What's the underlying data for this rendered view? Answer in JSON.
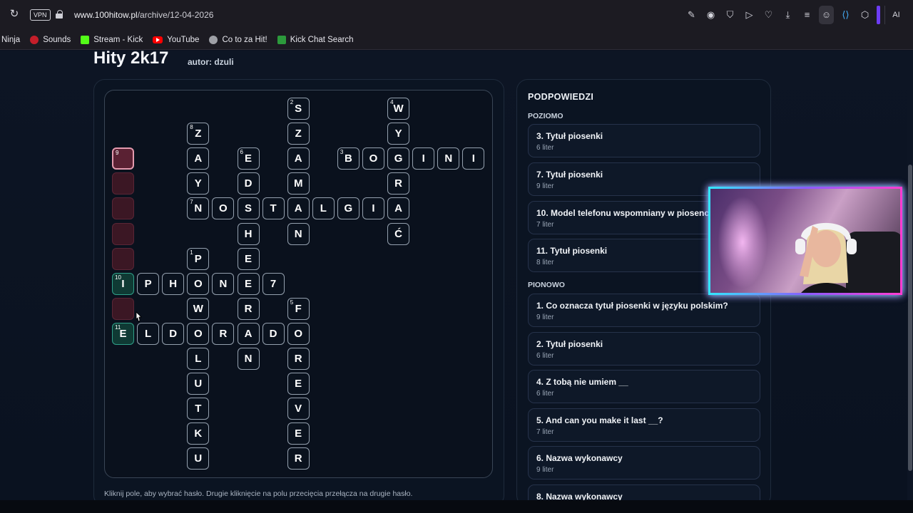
{
  "browser": {
    "vpn_label": "VPN",
    "url_host": "www.100hitow.pl",
    "url_path": "/archive/12-04-2026",
    "ai_label": "AI"
  },
  "bookmarks": [
    {
      "label": "Ninja",
      "icon": "none"
    },
    {
      "label": "Sounds",
      "icon": "sounds-icon"
    },
    {
      "label": "Stream - Kick",
      "icon": "kick-icon"
    },
    {
      "label": "YouTube",
      "icon": "youtube-icon"
    },
    {
      "label": "Co to za Hit!",
      "icon": "globe-icon"
    },
    {
      "label": "Kick Chat Search",
      "icon": "kick-chat-icon"
    }
  ],
  "page": {
    "title": "Hity 2k17",
    "author": "autor: dzuli",
    "hint": "Kliknij pole, aby wybrać hasło. Drugie kliknięcie na polu przecięcia przełącza na drugie hasło."
  },
  "crossword": {
    "cells": [
      {
        "c": 7,
        "r": 0,
        "ch": "S",
        "n": "2"
      },
      {
        "c": 11,
        "r": 0,
        "ch": "W",
        "n": "4"
      },
      {
        "c": 3,
        "r": 1,
        "ch": "Z",
        "n": "8"
      },
      {
        "c": 7,
        "r": 1,
        "ch": "Z"
      },
      {
        "c": 11,
        "r": 1,
        "ch": "Y"
      },
      {
        "c": 0,
        "r": 2,
        "ch": "",
        "n": "9",
        "style": "pink-sel"
      },
      {
        "c": 3,
        "r": 2,
        "ch": "A"
      },
      {
        "c": 5,
        "r": 2,
        "ch": "E",
        "n": "6"
      },
      {
        "c": 7,
        "r": 2,
        "ch": "A"
      },
      {
        "c": 9,
        "r": 2,
        "ch": "B",
        "n": "3"
      },
      {
        "c": 10,
        "r": 2,
        "ch": "O"
      },
      {
        "c": 11,
        "r": 2,
        "ch": "G"
      },
      {
        "c": 12,
        "r": 2,
        "ch": "I"
      },
      {
        "c": 13,
        "r": 2,
        "ch": "N"
      },
      {
        "c": 14,
        "r": 2,
        "ch": "I"
      },
      {
        "c": 0,
        "r": 3,
        "ch": "",
        "style": "pink"
      },
      {
        "c": 3,
        "r": 3,
        "ch": "Y"
      },
      {
        "c": 5,
        "r": 3,
        "ch": "D"
      },
      {
        "c": 7,
        "r": 3,
        "ch": "M"
      },
      {
        "c": 11,
        "r": 3,
        "ch": "R"
      },
      {
        "c": 0,
        "r": 4,
        "ch": "",
        "style": "pink"
      },
      {
        "c": 3,
        "r": 4,
        "ch": "N",
        "n": "7"
      },
      {
        "c": 4,
        "r": 4,
        "ch": "O"
      },
      {
        "c": 5,
        "r": 4,
        "ch": "S"
      },
      {
        "c": 6,
        "r": 4,
        "ch": "T"
      },
      {
        "c": 7,
        "r": 4,
        "ch": "A"
      },
      {
        "c": 8,
        "r": 4,
        "ch": "L"
      },
      {
        "c": 9,
        "r": 4,
        "ch": "G"
      },
      {
        "c": 10,
        "r": 4,
        "ch": "I"
      },
      {
        "c": 11,
        "r": 4,
        "ch": "A"
      },
      {
        "c": 0,
        "r": 5,
        "ch": "",
        "style": "pink"
      },
      {
        "c": 5,
        "r": 5,
        "ch": "H"
      },
      {
        "c": 7,
        "r": 5,
        "ch": "N"
      },
      {
        "c": 11,
        "r": 5,
        "ch": "Ć"
      },
      {
        "c": 0,
        "r": 6,
        "ch": "",
        "style": "pink"
      },
      {
        "c": 3,
        "r": 6,
        "ch": "P",
        "n": "1"
      },
      {
        "c": 5,
        "r": 6,
        "ch": "E"
      },
      {
        "c": 0,
        "r": 7,
        "ch": "I",
        "n": "10",
        "style": "green"
      },
      {
        "c": 1,
        "r": 7,
        "ch": "P"
      },
      {
        "c": 2,
        "r": 7,
        "ch": "H"
      },
      {
        "c": 3,
        "r": 7,
        "ch": "O"
      },
      {
        "c": 4,
        "r": 7,
        "ch": "N"
      },
      {
        "c": 5,
        "r": 7,
        "ch": "E"
      },
      {
        "c": 6,
        "r": 7,
        "ch": "7"
      },
      {
        "c": 0,
        "r": 8,
        "ch": "",
        "style": "pink"
      },
      {
        "c": 3,
        "r": 8,
        "ch": "W"
      },
      {
        "c": 5,
        "r": 8,
        "ch": "R"
      },
      {
        "c": 7,
        "r": 8,
        "ch": "F",
        "n": "5"
      },
      {
        "c": 0,
        "r": 9,
        "ch": "E",
        "n": "11",
        "style": "green"
      },
      {
        "c": 1,
        "r": 9,
        "ch": "L"
      },
      {
        "c": 2,
        "r": 9,
        "ch": "D"
      },
      {
        "c": 3,
        "r": 9,
        "ch": "O"
      },
      {
        "c": 4,
        "r": 9,
        "ch": "R"
      },
      {
        "c": 5,
        "r": 9,
        "ch": "A"
      },
      {
        "c": 6,
        "r": 9,
        "ch": "D"
      },
      {
        "c": 7,
        "r": 9,
        "ch": "O"
      },
      {
        "c": 3,
        "r": 10,
        "ch": "L"
      },
      {
        "c": 5,
        "r": 10,
        "ch": "N"
      },
      {
        "c": 7,
        "r": 10,
        "ch": "R"
      },
      {
        "c": 3,
        "r": 11,
        "ch": "U"
      },
      {
        "c": 7,
        "r": 11,
        "ch": "E"
      },
      {
        "c": 3,
        "r": 12,
        "ch": "T"
      },
      {
        "c": 7,
        "r": 12,
        "ch": "V"
      },
      {
        "c": 3,
        "r": 13,
        "ch": "K"
      },
      {
        "c": 7,
        "r": 13,
        "ch": "E"
      },
      {
        "c": 3,
        "r": 14,
        "ch": "U"
      },
      {
        "c": 7,
        "r": 14,
        "ch": "R"
      }
    ]
  },
  "hints": {
    "title": "PODPOWIEDZI",
    "across_label": "POZIOMO",
    "down_label": "PIONOWO",
    "across": [
      {
        "text": "3. Tytuł piosenki",
        "sub": "6 liter"
      },
      {
        "text": "7. Tytuł piosenki",
        "sub": "9 liter"
      },
      {
        "text": "10. Model telefonu wspomniany w piosence",
        "sub": "7 liter"
      },
      {
        "text": "11. Tytuł piosenki",
        "sub": "8 liter"
      }
    ],
    "down": [
      {
        "text": "1. Co oznacza tytuł piosenki w języku polskim?",
        "sub": "9 liter"
      },
      {
        "text": "2. Tytuł piosenki",
        "sub": "6 liter"
      },
      {
        "text": "4. Z tobą nie umiem __",
        "sub": "6 liter"
      },
      {
        "text": "5. And can you make it last __?",
        "sub": "7 liter"
      },
      {
        "text": "6. Nazwa wykonawcy",
        "sub": "9 liter"
      },
      {
        "text": "8. Nazwa wykonawcy",
        "sub": ""
      }
    ]
  }
}
